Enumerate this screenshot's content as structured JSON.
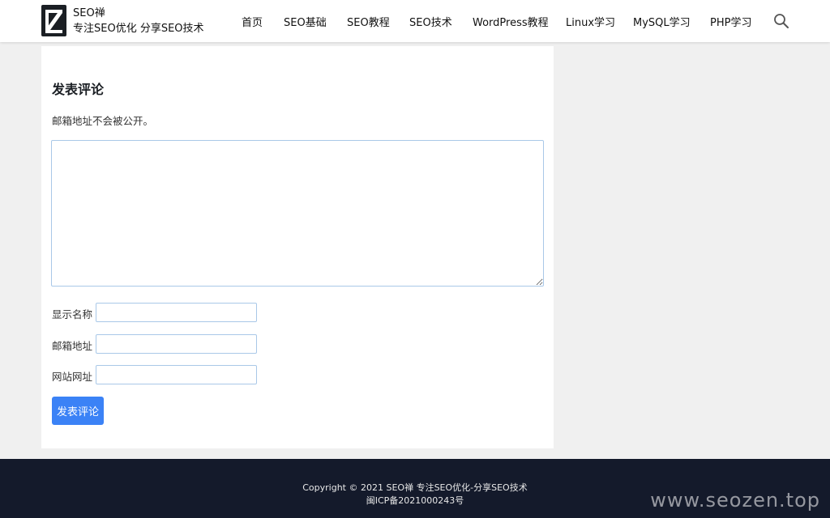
{
  "header": {
    "site_name": "SEO禅",
    "site_description": "专注SEO优化 分享SEO技术",
    "nav_items": [
      {
        "label": "首页"
      },
      {
        "label": "SEO基础"
      },
      {
        "label": "SEO教程"
      },
      {
        "label": "SEO技术"
      },
      {
        "label": "WordPress教程"
      },
      {
        "label": "Linux学习"
      },
      {
        "label": "MySQL学习"
      },
      {
        "label": "PHP学习"
      }
    ],
    "search_icon": "search-icon"
  },
  "comment_form": {
    "title": "发表评论",
    "notes": "邮箱地址不会被公开。",
    "comment_value": "",
    "fields": [
      {
        "label": "显示名称",
        "value": ""
      },
      {
        "label": "邮箱地址",
        "value": ""
      },
      {
        "label": "网站网址",
        "value": ""
      }
    ],
    "submit_label": "发表评论"
  },
  "footer": {
    "copyright": "Copyright © 2021 SEO禅 专注SEO优化-分享SEO技术",
    "icp": "闽ICP备2021000243号",
    "watermark": "www.seozen.top"
  },
  "colors": {
    "button": "#3b82f6",
    "footer_bg": "#141a2b",
    "input_border": "#a9c8e8"
  }
}
